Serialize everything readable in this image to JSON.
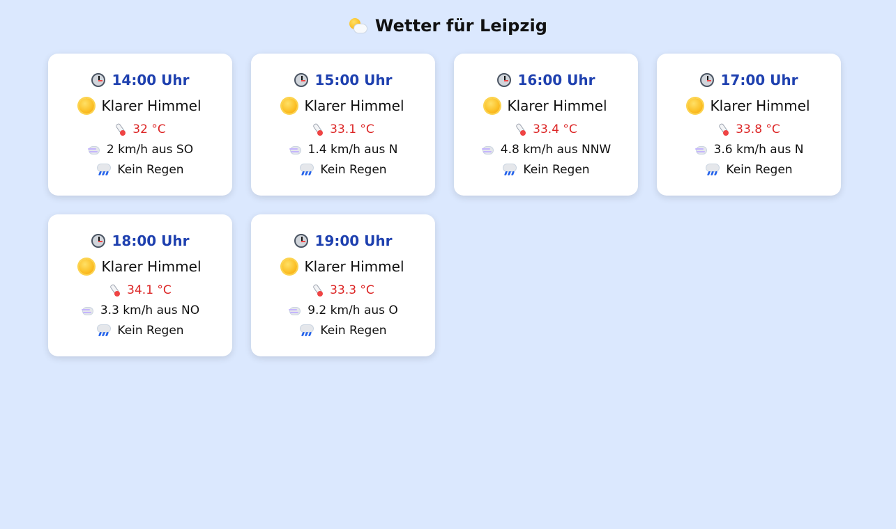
{
  "header": {
    "title": "Wetter für Leipzig",
    "icon": "sun-behind-cloud-icon"
  },
  "icons": {
    "time": "clock-icon",
    "condition": "sun-icon",
    "temperature": "thermometer-icon",
    "wind": "wind-icon",
    "rain": "cloud-rain-icon"
  },
  "colors": {
    "background": "#dbe8fe",
    "card": "#ffffff",
    "time_text": "#1e40af",
    "temperature_text": "#dc2626",
    "text": "#111111"
  },
  "cards": [
    {
      "time": "14:00 Uhr",
      "condition": "Klarer Himmel",
      "temperature": "32 °C",
      "wind": "2 km/h aus SO",
      "rain": "Kein Regen"
    },
    {
      "time": "15:00 Uhr",
      "condition": "Klarer Himmel",
      "temperature": "33.1 °C",
      "wind": "1.4 km/h aus N",
      "rain": "Kein Regen"
    },
    {
      "time": "16:00 Uhr",
      "condition": "Klarer Himmel",
      "temperature": "33.4 °C",
      "wind": "4.8 km/h aus NNW",
      "rain": "Kein Regen"
    },
    {
      "time": "17:00 Uhr",
      "condition": "Klarer Himmel",
      "temperature": "33.8 °C",
      "wind": "3.6 km/h aus N",
      "rain": "Kein Regen"
    },
    {
      "time": "18:00 Uhr",
      "condition": "Klarer Himmel",
      "temperature": "34.1 °C",
      "wind": "3.3 km/h aus NO",
      "rain": "Kein Regen"
    },
    {
      "time": "19:00 Uhr",
      "condition": "Klarer Himmel",
      "temperature": "33.3 °C",
      "wind": "9.2 km/h aus O",
      "rain": "Kein Regen"
    }
  ]
}
